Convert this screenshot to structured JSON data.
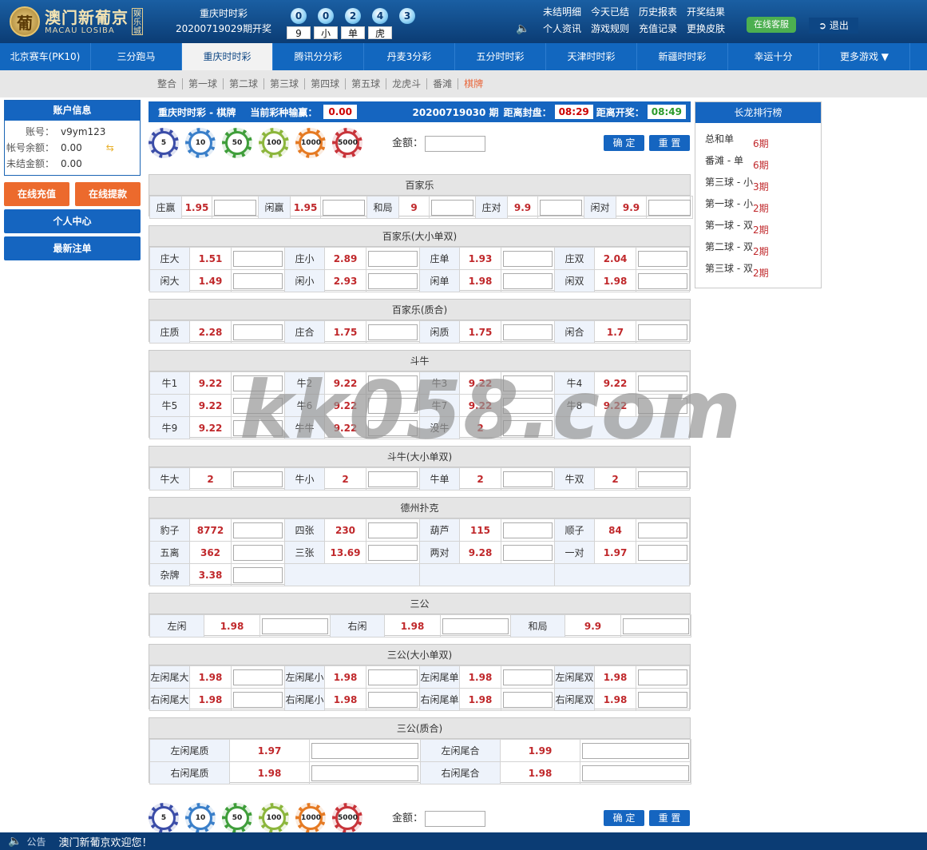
{
  "header": {
    "logo_cn": "澳门新葡京",
    "logo_en": "MACAU LOSIBA",
    "logo_vert": "娱乐城",
    "logo_emblem": "葡",
    "game_name": "重庆时时彩",
    "period_text": "20200719029期开奖",
    "balls": [
      "0",
      "0",
      "2",
      "4",
      "3"
    ],
    "ball_labels": [
      "9",
      "小",
      "单",
      "虎"
    ],
    "links": [
      "未结明细",
      "今天已结",
      "历史报表",
      "开奖结果",
      "个人资讯",
      "游戏规则",
      "充值记录",
      "更换皮肤"
    ],
    "service": "在线客服",
    "logout": "退出"
  },
  "nav": {
    "tabs": [
      "北京赛车(PK10)",
      "三分跑马",
      "重庆时时彩",
      "腾讯分分彩",
      "丹麦3分彩",
      "五分时时彩",
      "天津时时彩",
      "新疆时时彩",
      "幸运十分",
      "更多游戏 ▼"
    ]
  },
  "subnav": {
    "items": [
      "整合",
      "第一球",
      "第二球",
      "第三球",
      "第四球",
      "第五球",
      "龙虎斗",
      "番滩",
      "棋牌"
    ]
  },
  "sidebar": {
    "title": "账户信息",
    "account_label": "账号：",
    "account_value": "v9ym123",
    "balance_label": "帐号余额：",
    "balance_value": "0.00",
    "unsettled_label": "未结金额：",
    "unsettled_value": "0.00",
    "recharge": "在线充值",
    "withdraw": "在线提款",
    "personal": "个人中心",
    "latest": "最新注单"
  },
  "topbar": {
    "game": "重庆时时彩 - 棋牌",
    "ratio_label": "当前彩种输赢：",
    "ratio_value": "0.00",
    "issue": "20200719030 期",
    "close_label": "距离封盘：",
    "close_time": "08:29",
    "open_label": "距离开奖：",
    "open_time": "08:49"
  },
  "chips": [
    "5",
    "10",
    "50",
    "100",
    "1000",
    "5000"
  ],
  "chip_colors": [
    "#3b4da8",
    "#3a7fc9",
    "#3f9e3a",
    "#8cb63c",
    "#e57a23",
    "#c8343a"
  ],
  "amount_label": "金额：",
  "confirm": "确 定",
  "reset": "重 置",
  "sections": {
    "baccarat": {
      "title": "百家乐",
      "cells": [
        [
          "庄赢",
          "1.95"
        ],
        [
          "闲赢",
          "1.95"
        ],
        [
          "和局",
          "9"
        ],
        [
          "庄对",
          "9.9"
        ],
        [
          "闲对",
          "9.9"
        ]
      ]
    },
    "baccarat_bs": {
      "title": "百家乐(大小单双)",
      "rows": [
        [
          [
            "庄大",
            "1.51"
          ],
          [
            "庄小",
            "2.89"
          ],
          [
            "庄单",
            "1.93"
          ],
          [
            "庄双",
            "2.04"
          ]
        ],
        [
          [
            "闲大",
            "1.49"
          ],
          [
            "闲小",
            "2.93"
          ],
          [
            "闲单",
            "1.98"
          ],
          [
            "闲双",
            "1.98"
          ]
        ]
      ]
    },
    "baccarat_pc": {
      "title": "百家乐(质合)",
      "rows": [
        [
          [
            "庄质",
            "2.28"
          ],
          [
            "庄合",
            "1.75"
          ],
          [
            "闲质",
            "1.75"
          ],
          [
            "闲合",
            "1.7"
          ]
        ]
      ]
    },
    "niuniu": {
      "title": "斗牛",
      "rows": [
        [
          [
            "牛1",
            "9.22"
          ],
          [
            "牛2",
            "9.22"
          ],
          [
            "牛3",
            "9.22"
          ],
          [
            "牛4",
            "9.22"
          ]
        ],
        [
          [
            "牛5",
            "9.22"
          ],
          [
            "牛6",
            "9.22"
          ],
          [
            "牛7",
            "9.22"
          ],
          [
            "牛8",
            "9.22"
          ]
        ],
        [
          [
            "牛9",
            "9.22"
          ],
          [
            "牛牛",
            "9.22"
          ],
          [
            "没牛",
            "2"
          ]
        ]
      ]
    },
    "niuniu_bs": {
      "title": "斗牛(大小单双)",
      "rows": [
        [
          [
            "牛大",
            "2"
          ],
          [
            "牛小",
            "2"
          ],
          [
            "牛单",
            "2"
          ],
          [
            "牛双",
            "2"
          ]
        ]
      ]
    },
    "texas": {
      "title": "德州扑克",
      "rows": [
        [
          [
            "豹子",
            "8772"
          ],
          [
            "四张",
            "230"
          ],
          [
            "葫芦",
            "115"
          ],
          [
            "顺子",
            "84"
          ]
        ],
        [
          [
            "五离",
            "362"
          ],
          [
            "三张",
            "13.69"
          ],
          [
            "两对",
            "9.28"
          ],
          [
            "一对",
            "1.97"
          ]
        ],
        [
          [
            "杂牌",
            "3.38"
          ]
        ]
      ]
    },
    "sangong": {
      "title": "三公",
      "cells": [
        [
          "左闲",
          "1.98"
        ],
        [
          "右闲",
          "1.98"
        ],
        [
          "和局",
          "9.9"
        ]
      ]
    },
    "sangong_bs": {
      "title": "三公(大小单双)",
      "rows": [
        [
          [
            "左闲尾大",
            "1.98"
          ],
          [
            "左闲尾小",
            "1.98"
          ],
          [
            "左闲尾单",
            "1.98"
          ],
          [
            "左闲尾双",
            "1.98"
          ]
        ],
        [
          [
            "右闲尾大",
            "1.98"
          ],
          [
            "右闲尾小",
            "1.98"
          ],
          [
            "右闲尾单",
            "1.98"
          ],
          [
            "右闲尾双",
            "1.98"
          ]
        ]
      ]
    },
    "sangong_pc": {
      "title": "三公(质合)",
      "rows": [
        [
          [
            "左闲尾质",
            "1.97"
          ],
          [
            "左闲尾合",
            "1.99"
          ]
        ],
        [
          [
            "右闲尾质",
            "1.98"
          ],
          [
            "右闲尾合",
            "1.98"
          ]
        ]
      ]
    }
  },
  "rank": {
    "title": "长龙排行榜",
    "items": [
      [
        "总和单",
        "6期"
      ],
      [
        "番滩 - 单",
        "6期"
      ],
      [
        "第三球 - 小",
        "3期"
      ],
      [
        "第一球 - 小",
        "2期"
      ],
      [
        "第一球 - 双",
        "2期"
      ],
      [
        "第二球 - 双",
        "2期"
      ],
      [
        "第三球 - 双",
        "2期"
      ]
    ]
  },
  "watermark": "kk058.com",
  "footer": {
    "label": "公告",
    "message": "澳门新葡京欢迎您！"
  }
}
